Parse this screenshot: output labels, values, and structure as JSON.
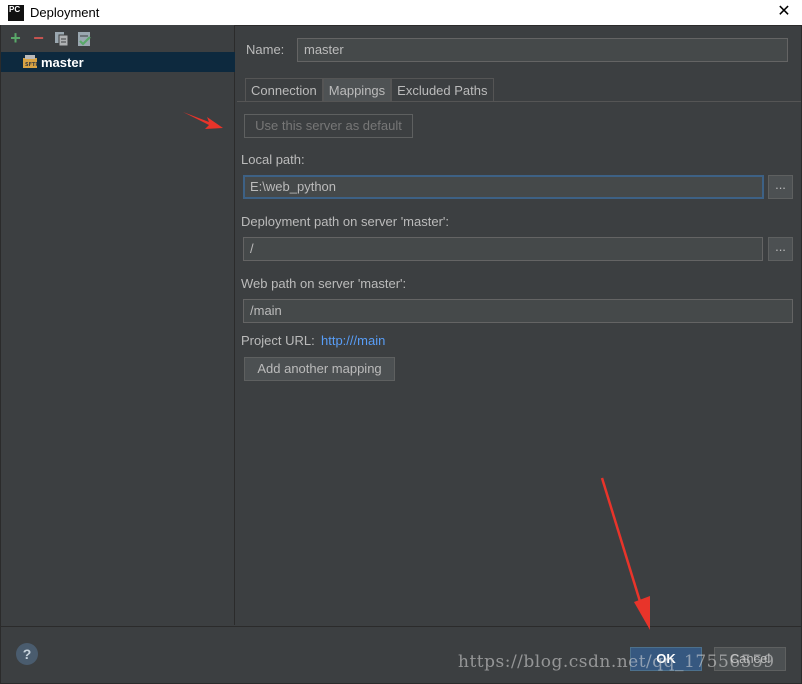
{
  "window": {
    "title": "Deployment",
    "app_icon_text": "PC",
    "close_glyph": "✕"
  },
  "sidebar": {
    "toolbar": {
      "add_glyph": "+",
      "remove_glyph": "−",
      "copy_icon": "copy-icon",
      "default_icon": "set-default-icon"
    },
    "servers": [
      {
        "label": "master",
        "selected": true,
        "icon": "sftp-server-icon"
      }
    ]
  },
  "form": {
    "name_label": "Name:",
    "name_value": "master",
    "tabs": [
      {
        "label": "Connection",
        "active": false
      },
      {
        "label": "Mappings",
        "active": true
      },
      {
        "label": "Excluded Paths",
        "active": false
      }
    ],
    "use_default_button": "Use this server as default",
    "local_path_label": "Local path:",
    "local_path_value": "E:\\web_python",
    "deployment_path_label": "Deployment path on server 'master':",
    "deployment_path_value": "/",
    "web_path_label": "Web path on server 'master':",
    "web_path_value": "/main",
    "project_url_label": "Project URL:",
    "project_url_value": "http:///main",
    "browse_glyph": "...",
    "add_mapping_button": "Add another mapping"
  },
  "footer": {
    "help_glyph": "?",
    "ok_label": "OK",
    "cancel_label": "Cancel"
  },
  "overlay": {
    "watermark": "https://blog.csdn.net/qq_17556559"
  },
  "colors": {
    "background": "#3c3f41",
    "selection": "#0d293e",
    "ok_button": "#365880",
    "link": "#589df6",
    "annotation_arrow": "#e8342a"
  }
}
